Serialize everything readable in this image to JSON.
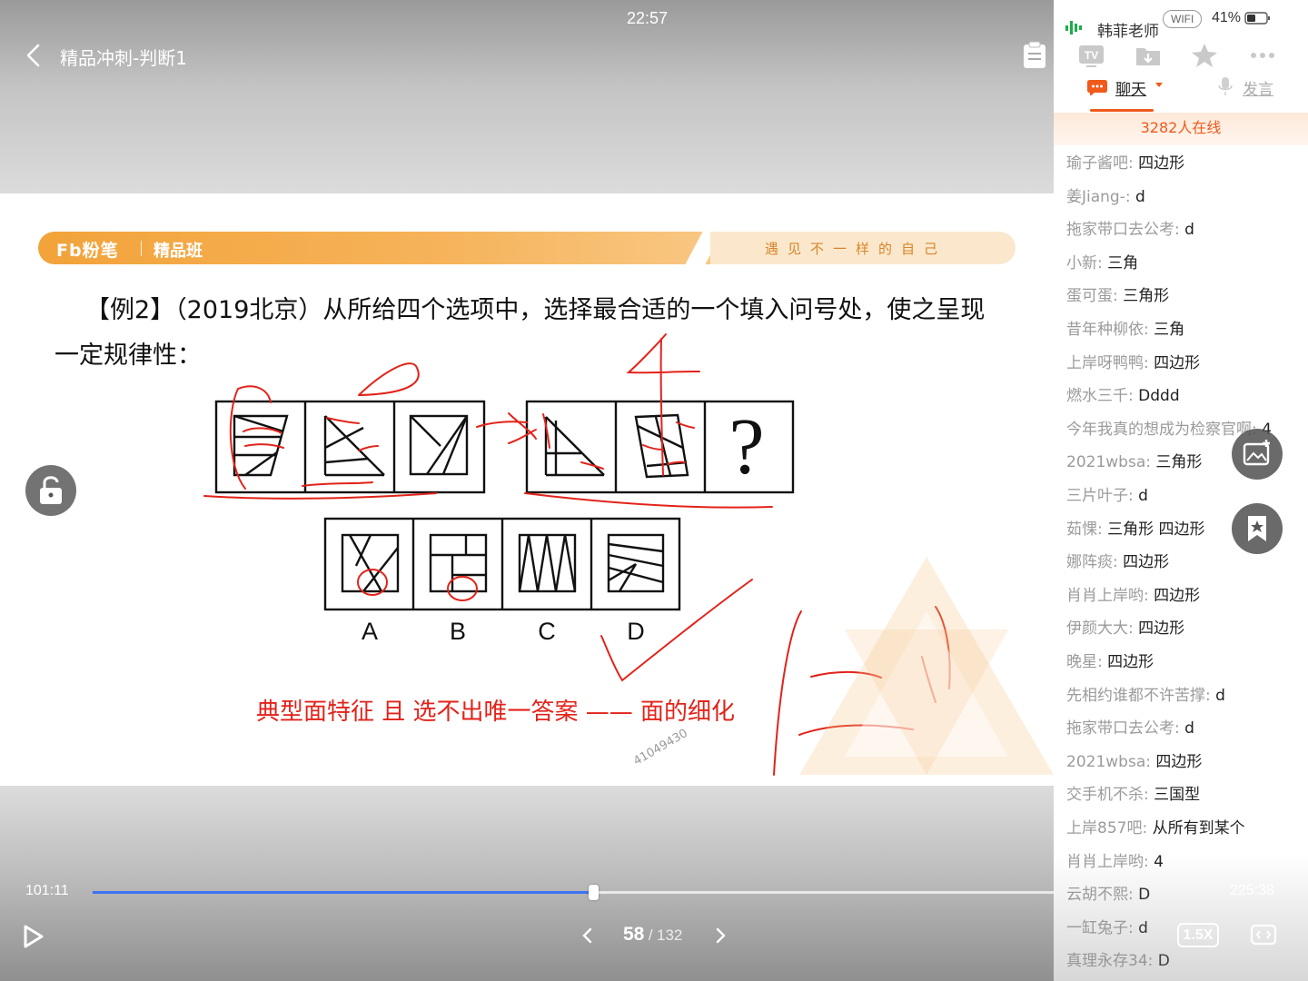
{
  "status": {
    "time": "22:57",
    "teacher": "韩菲老师",
    "network": "WIFI",
    "battery": "41%"
  },
  "header": {
    "title": "精品冲刺-判断1"
  },
  "slide": {
    "brand_logo": "Fb粉笔",
    "brand_class": "精品班",
    "slogan": "遇见不一样的自己",
    "question_prefix": "【例2】",
    "question_body": "（2019北京）从所给四个选项中，选择最合适的一个填入问号处，使之呈现一定规律性：",
    "question_mark": "?",
    "options": [
      "A",
      "B",
      "C",
      "D"
    ],
    "annotation": "典型面特征 且 选不出唯一答案 —— 面的细化",
    "watermark_id": "41049430"
  },
  "player": {
    "time_current": "101:11",
    "time_total": "225:38",
    "progress": 0.445,
    "page_current": "58",
    "page_sep": "/",
    "page_total": "132",
    "speed": "1.5X",
    "accent_color": "#3d72f2"
  },
  "chat": {
    "tab_chat": "聊天",
    "tab_speak": "发言",
    "online": "3282人在线",
    "messages": [
      {
        "user": "瑜子酱吧:",
        "text": "四边形"
      },
      {
        "user": "姜Jiang-:",
        "text": "d"
      },
      {
        "user": "拖家带口去公考:",
        "text": "d"
      },
      {
        "user": "小新:",
        "text": "三角"
      },
      {
        "user": "蛋可蛋:",
        "text": "三角形"
      },
      {
        "user": "昔年种柳依:",
        "text": "三角"
      },
      {
        "user": "上岸呀鸭鸭:",
        "text": "四边形"
      },
      {
        "user": "燃水三千:",
        "text": "Dddd"
      },
      {
        "user": "今年我真的想成为检察官啊:",
        "text": "4"
      },
      {
        "user": "2021wbsa:",
        "text": "三角形"
      },
      {
        "user": "三片叶子:",
        "text": "d"
      },
      {
        "user": "茹惈:",
        "text": "三角形 四边形"
      },
      {
        "user": "娜阵痰:",
        "text": "四边形"
      },
      {
        "user": "肖肖上岸哟:",
        "text": "四边形"
      },
      {
        "user": "伊颜大大:",
        "text": "四边形"
      },
      {
        "user": "晚星:",
        "text": "四边形"
      },
      {
        "user": "先相约谁都不许苦撑:",
        "text": "d"
      },
      {
        "user": "拖家带口去公考:",
        "text": "d"
      },
      {
        "user": "2021wbsa:",
        "text": "四边形"
      },
      {
        "user": "交手机不杀:",
        "text": "三国型"
      },
      {
        "user": "上岸857吧:",
        "text": "从所有到某个"
      },
      {
        "user": "肖肖上岸哟:",
        "text": "4"
      },
      {
        "user": "云胡不熙:",
        "text": "D"
      },
      {
        "user": "一缸兔子:",
        "text": "d"
      },
      {
        "user": "真理永存34:",
        "text": "D"
      }
    ]
  },
  "colors": {
    "brand_orange": "#f2a33a",
    "chat_accent": "#f05a1a",
    "annotation_red": "#e2231a"
  }
}
